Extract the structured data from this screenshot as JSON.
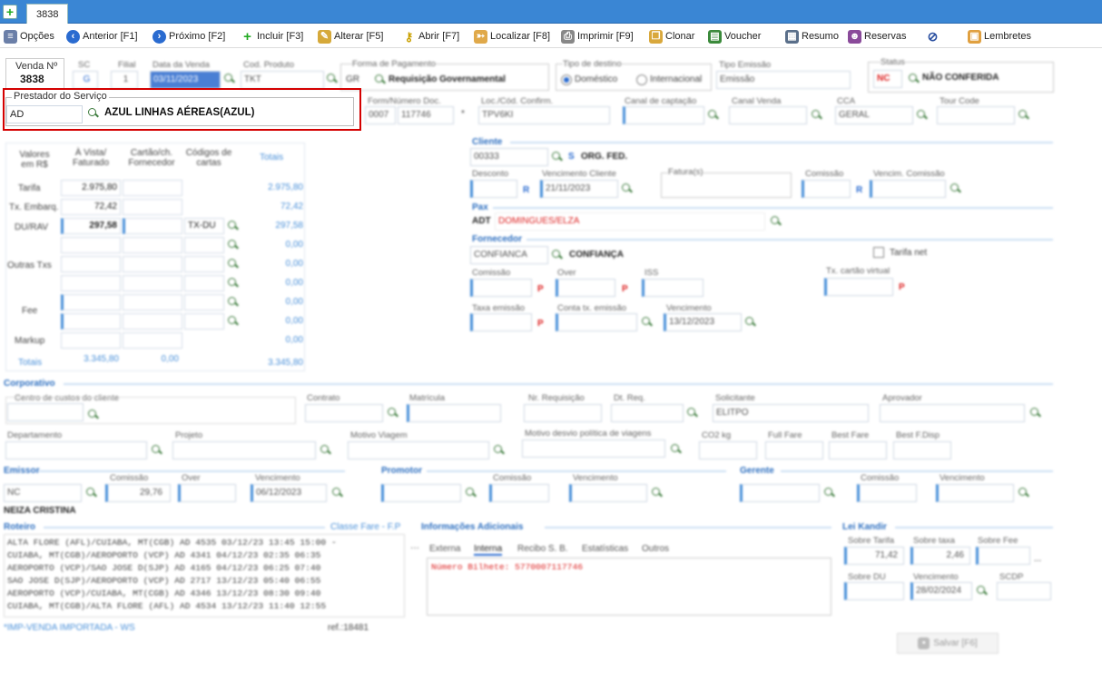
{
  "window": {
    "tab_label": "3838"
  },
  "toolbar": {
    "opcoes": "Opções",
    "anterior": "Anterior [F1]",
    "proximo": "Próximo [F2]",
    "incluir": "Incluir [F3]",
    "alterar": "Alterar [F5]",
    "abrir": "Abrir [F7]",
    "localizar": "Localizar [F8]",
    "imprimir": "Imprimir [F9]",
    "clonar": "Clonar",
    "voucher": "Voucher",
    "resumo": "Resumo",
    "reservas": "Reservas",
    "lembretes": "Lembretes"
  },
  "header": {
    "venda_label": "Venda Nº",
    "venda_value": "3838",
    "sc_label": "SC",
    "sc_value": "G",
    "filial_label": "Filial",
    "filial_value": "1",
    "data_label": "Data da Venda",
    "data_value": "03/11/2023",
    "cod_produto_label": "Cod. Produto",
    "cod_produto_value": "TKT",
    "forma_pag_label": "Forma de Pagamento",
    "forma_pag_code": "GR",
    "forma_pag_value": "Requisição Governamental",
    "tipo_destino_label": "Tipo de destino",
    "domestico": "Doméstico",
    "internacional": "Internacional",
    "tipo_emissao_label": "Tipo Emissão",
    "tipo_emissao_value": "Emissão",
    "status_label": "Status",
    "status_code": "NC",
    "status_value": "NÃO CONFERIDA"
  },
  "prestador": {
    "label": "Prestador do Serviço",
    "code": "AD",
    "name": "AZUL LINHAS AÉREAS(AZUL)"
  },
  "row2": {
    "form_label": "Form/Número Doc.",
    "form_value": "0007",
    "num_value": "117746",
    "loc_label": "Loc./Cód. Confirm.",
    "loc_value": "TPV6KI",
    "canal_cap_label": "Canal de captação",
    "canal_venda_label": "Canal Venda",
    "cca_label": "CCA",
    "cca_value": "GERAL",
    "tour_label": "Tour Code"
  },
  "valores": {
    "col1": "Valores em R$",
    "col2": "À Vista/ Faturado",
    "col3": "Cartão/ch. Fornecedor",
    "col4": "Códigos de cartas",
    "col5": "Totais",
    "tarifa": "Tarifa",
    "tarifa_val": "2.975,80",
    "tarifa_tot": "2.975,80",
    "tx_embarq": "Tx. Embarq.",
    "tx_val": "72,42",
    "tx_tot": "72,42",
    "du_rav": "DU/RAV",
    "du_val": "297,58",
    "du_code": "TX-DU",
    "du_tot": "297,58",
    "z1": "0,00",
    "z2": "0,00",
    "outras": "Outras Txs",
    "z3": "0,00",
    "z4": "0,00",
    "fee": "Fee",
    "z5": "0,00",
    "z6": "0,00",
    "markup": "Markup",
    "z7": "0,00",
    "totais": "Totais",
    "tot_avista": "3.345,80",
    "tot_cartao": "0,00",
    "tot_geral": "3.345,80"
  },
  "cliente": {
    "section": "Cliente",
    "code": "00333",
    "flag": "S",
    "name": "ORG. FED.",
    "desconto": "Desconto",
    "venc_cliente": "Vencimento Cliente",
    "venc_value": "21/11/2023",
    "faturas": "Fatura(s)",
    "comissao": "Comissão",
    "venc_comissao": "Vencim. Comissão"
  },
  "pax": {
    "section": "Pax",
    "prefix": "ADT",
    "name": "DOMINGUES/ELZA"
  },
  "fornecedor": {
    "section": "Fornecedor",
    "code": "CONFIANCA",
    "name": "CONFIANÇA",
    "tarifa_net": "Tarifa net",
    "comissao": "Comissão",
    "over": "Over",
    "iss": "ISS",
    "tx_cartao": "Tx. cartão virtual",
    "taxa_emissao": "Taxa emissão",
    "conta_tx": "Conta tx. emissão",
    "vencimento": "Vencimento",
    "venc_value": "13/12/2023"
  },
  "corporativo": {
    "section": "Corporativo",
    "centro": "Centro de custos do cliente",
    "contrato": "Contrato",
    "matricula": "Matrícula",
    "requisicao": "Nr. Requisição",
    "dt_req": "Dt. Req.",
    "solicitante": "Solicitante",
    "solicitante_value": "ELITPO",
    "aprovador": "Aprovador",
    "departamento": "Departamento",
    "projeto": "Projeto",
    "motivo": "Motivo Viagem",
    "motivo_desvio": "Motivo desvio política de viagens",
    "co2": "CO2 kg",
    "full": "Full Fare",
    "best": "Best Fare",
    "bestf": "Best F.Disp"
  },
  "emissor": {
    "section": "Emissor",
    "comissao": "Comissão",
    "over": "Over",
    "vencimento": "Vencimento",
    "code": "NC",
    "com_value": "29,76",
    "venc_value": "06/12/2023",
    "name": "NEIZA CRISTINA"
  },
  "promotor": {
    "section": "Promotor",
    "comissao": "Comissão",
    "vencimento": "Vencimento"
  },
  "gerente": {
    "section": "Gerente",
    "comissao": "Comissão",
    "vencimento": "Vencimento"
  },
  "roteiro": {
    "section": "Roteiro",
    "classe": "Classe Fare - F.P",
    "lines": [
      "ALTA FLORE (AFL)/CUIABA, MT(CGB) AD 4535 03/12/23 13:45 15:00 -",
      "CUIABA, MT(CGB)/AEROPORTO (VCP) AD 4341 04/12/23 02:35 06:35",
      "AEROPORTO (VCP)/SAO JOSE D(SJP) AD 4165 04/12/23 06:25 07:40",
      "SAO JOSE D(SJP)/AEROPORTO (VCP) AD 2717 13/12/23 05:40 06:55",
      "AEROPORTO (VCP)/CUIABA, MT(CGB) AD 4346 13/12/23 08:30 09:40",
      "CUIABA, MT(CGB)/ALTA FLORE (AFL) AD 4534 13/12/23 11:40 12:55"
    ],
    "footer": "*IMP-VENDA IMPORTADA - WS",
    "ref": "ref.:18481"
  },
  "info": {
    "section": "Informações Adicionais",
    "tabs": [
      "Externa",
      "Interna",
      "Recibo S. B.",
      "Estatísticas",
      "Outros"
    ],
    "text": "Número Bilhete: 5770007117746"
  },
  "lei": {
    "section": "Lei Kandir",
    "sobre_tarifa": "Sobre Tarifa",
    "sobre_taxa": "Sobre taxa",
    "sobre_fee": "Sobre Fee",
    "v1": "71,42",
    "v2": "2,46",
    "sobre_du": "Sobre DU",
    "vencimento": "Vencimento",
    "venc_value": "28/02/2024",
    "scdp": "SCDP"
  },
  "footer": {
    "salvar": "Salvar [F6]"
  }
}
